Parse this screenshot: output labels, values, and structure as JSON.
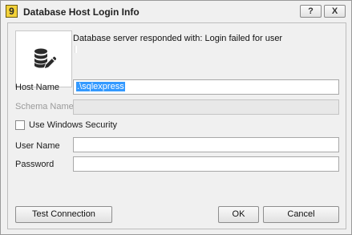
{
  "window": {
    "title": "Database Host Login Info",
    "app_icon_glyph": "9",
    "help_label": "?",
    "close_label": "X"
  },
  "message": "Database server responded with: Login failed for user",
  "form": {
    "host_label": "Host Name",
    "host_value": ".\\sqlexpress",
    "schema_label": "Schema Name",
    "schema_value": "",
    "windows_security_label": "Use Windows Security",
    "windows_security_checked": false,
    "user_label": "User Name",
    "user_value": "",
    "password_label": "Password",
    "password_value": ""
  },
  "buttons": {
    "test_connection": "Test Connection",
    "ok": "OK",
    "cancel": "Cancel"
  },
  "colors": {
    "selection": "#3399ff",
    "app_icon": "#f3d23a"
  },
  "icons": {
    "app": "app-logo-icon",
    "database": "database-edit-icon"
  }
}
